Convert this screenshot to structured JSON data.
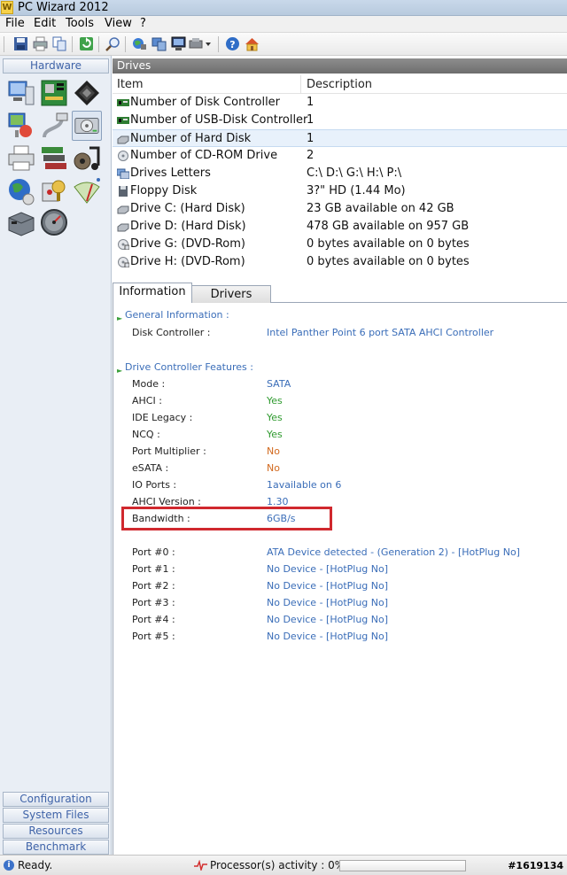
{
  "window": {
    "title": "PC Wizard 2012",
    "icon_letter": "W"
  },
  "menu": [
    "File",
    "Edit",
    "Tools",
    "View",
    "?"
  ],
  "toolbar": {
    "icons": [
      "save-icon",
      "print-icon",
      "copy-icon",
      "refresh-icon",
      "search-icon",
      "network-icon",
      "system-icon",
      "monitor-icon",
      "tools-icon",
      "help-icon",
      "home-icon"
    ]
  },
  "sidebar": {
    "header": "Hardware",
    "bottom_tabs": [
      "Configuration",
      "System Files",
      "Resources",
      "Benchmark"
    ]
  },
  "drives_panel": {
    "title": "Drives",
    "columns": {
      "item": "Item",
      "description": "Description"
    },
    "rows": [
      {
        "item": "Number of Disk Controller",
        "desc": "1",
        "icon": "controller-icon"
      },
      {
        "item": "Number of USB-Disk Controller",
        "desc": "1",
        "icon": "controller-icon"
      },
      {
        "item": "Number of Hard Disk",
        "desc": "1",
        "icon": "hard-disk-icon"
      },
      {
        "item": "Number of CD-ROM Drive",
        "desc": "2",
        "icon": "cdrom-icon"
      },
      {
        "item": "Drives Letters",
        "desc": "C:\\ D:\\ G:\\ H:\\ P:\\",
        "icon": "drives-icon"
      },
      {
        "item": "Floppy Disk",
        "desc": "3?\" HD (1.44 Mo)",
        "icon": "floppy-icon"
      },
      {
        "item": "Drive C: (Hard Disk)",
        "desc": "23 GB available on 42 GB",
        "icon": "hard-disk-icon"
      },
      {
        "item": "Drive D: (Hard Disk)",
        "desc": "478 GB available on 957 GB",
        "icon": "hard-disk-icon"
      },
      {
        "item": "Drive G: (DVD-Rom)",
        "desc": "0 bytes available on 0 bytes",
        "icon": "dvd-icon"
      },
      {
        "item": "Drive H: (DVD-Rom)",
        "desc": "0 bytes available on 0 bytes",
        "icon": "dvd-icon"
      }
    ]
  },
  "tabs": [
    "Information",
    "Drivers"
  ],
  "info": {
    "general_title": "General Information :",
    "disk_controller_label": "Disk Controller :",
    "disk_controller_value": "Intel Panther Point 6 port SATA AHCI Controller",
    "features_title": "Drive Controller Features :",
    "features": [
      {
        "label": "Mode :",
        "value": "SATA"
      },
      {
        "label": "AHCI :",
        "value": "Yes"
      },
      {
        "label": "IDE Legacy :",
        "value": "Yes"
      },
      {
        "label": "NCQ :",
        "value": "Yes"
      },
      {
        "label": "Port Multiplier :",
        "value": "No"
      },
      {
        "label": "eSATA :",
        "value": "No"
      },
      {
        "label": "IO Ports :",
        "value": "1available on 6"
      },
      {
        "label": "AHCI Version :",
        "value": "1.30"
      },
      {
        "label": "Bandwidth :",
        "value": "6GB/s"
      }
    ],
    "ports": [
      {
        "label": "Port #0 :",
        "value": "ATA Device detected  -  (Generation 2)  -  [HotPlug No]"
      },
      {
        "label": "Port #1 :",
        "value": "No Device  -  [HotPlug No]"
      },
      {
        "label": "Port #2 :",
        "value": "No Device  -  [HotPlug No]"
      },
      {
        "label": "Port #3 :",
        "value": "No Device  -  [HotPlug No]"
      },
      {
        "label": "Port #4 :",
        "value": "No Device  -  [HotPlug No]"
      },
      {
        "label": "Port #5 :",
        "value": "No Device  -  [HotPlug No]"
      }
    ]
  },
  "status": {
    "ready": "Ready.",
    "processor": "Processor(s) activity : 0%",
    "processor_percent": 0,
    "watermark": "#1619134"
  },
  "colors": {
    "accent": "#3a6db8",
    "yes": "#2e9a2e",
    "no": "#d2691e",
    "highlight": "#d0282e"
  }
}
